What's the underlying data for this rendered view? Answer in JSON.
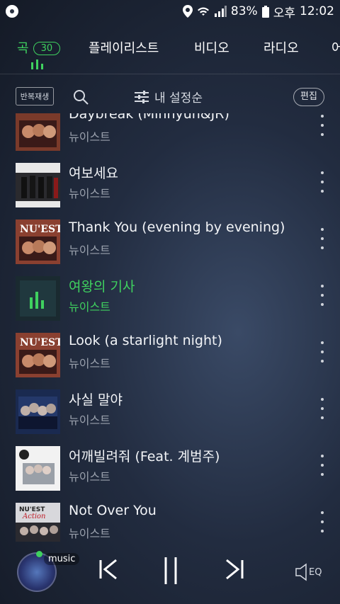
{
  "status": {
    "battery": "83%",
    "ampm": "오후",
    "time": "12:02"
  },
  "tabs": [
    {
      "label": "곡",
      "count": "30"
    },
    {
      "label": "플레이리스트"
    },
    {
      "label": "비디오"
    },
    {
      "label": "라디오"
    },
    {
      "label": "어"
    }
  ],
  "toolbar": {
    "repeat": "반복재생",
    "sort": "내 설정순",
    "edit": "편집"
  },
  "songs": [
    {
      "title": "Daybreak (Minhyun&JR)",
      "artist": "뉴이스트"
    },
    {
      "title": "여보세요",
      "artist": "뉴이스트"
    },
    {
      "title": "Thank You (evening by evening)",
      "artist": "뉴이스트"
    },
    {
      "title": "여왕의 기사",
      "artist": "뉴이스트",
      "playing": true
    },
    {
      "title": "Look (a starlight night)",
      "artist": "뉴이스트"
    },
    {
      "title": "사실 말야",
      "artist": "뉴이스트"
    },
    {
      "title": "어깨빌려줘 (Feat. 계범주)",
      "artist": "뉴이스트"
    },
    {
      "title": "Not Over You",
      "artist": "뉴이스트"
    }
  ],
  "album_art_text": {
    "nuest": "NU'EST",
    "action": "Action"
  },
  "player": {
    "label": "music",
    "eq": "EQ"
  },
  "colors": {
    "accent": "#3fd15f"
  }
}
